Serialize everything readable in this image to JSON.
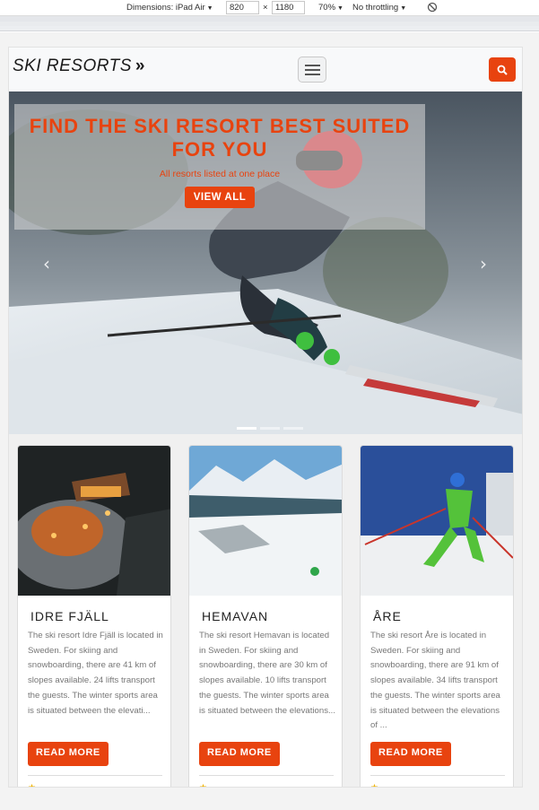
{
  "devtools": {
    "device_label": "Dimensions: iPad Air",
    "width": "820",
    "height": "1180",
    "times": "×",
    "zoom": "70%",
    "throttle": "No throttling"
  },
  "header": {
    "brand": "SKI RESORTS",
    "brand_icon": "double-chevron-right-icon",
    "menu_icon": "hamburger-icon",
    "search_icon": "search-icon"
  },
  "hero": {
    "title": "FIND THE SKI RESORT BEST SUITED FOR YOU",
    "subtitle": "All resorts listed at one place",
    "cta": "VIEW ALL",
    "prev_icon": "chevron-left-icon",
    "next_icon": "chevron-right-icon"
  },
  "cards": [
    {
      "title": "IDRE FJÄLL",
      "text": "The ski resort Idre Fjäll is located in Sweden. For skiing and snowboarding, there are 41 km of slopes available. 24 lifts transport the guests. The winter sports area is situated between the elevati...",
      "button": "READ MORE"
    },
    {
      "title": "HEMAVAN",
      "text": "The ski resort Hemavan is located in Sweden. For skiing and snowboarding, there are 30 km of slopes available. 10 lifts transport the guests. The winter sports area is situated between the elevations...",
      "button": "READ MORE"
    },
    {
      "title": "ÅRE",
      "text": "The ski resort Åre is located in Sweden. For skiing and snowboarding, there are 91 km of slopes available. 34 lifts transport the guests. The winter sports area is situated between the elevations of ...",
      "button": "READ MORE"
    }
  ],
  "colors": {
    "accent": "#e8430f",
    "navbar_bg": "#f8f9fa"
  }
}
